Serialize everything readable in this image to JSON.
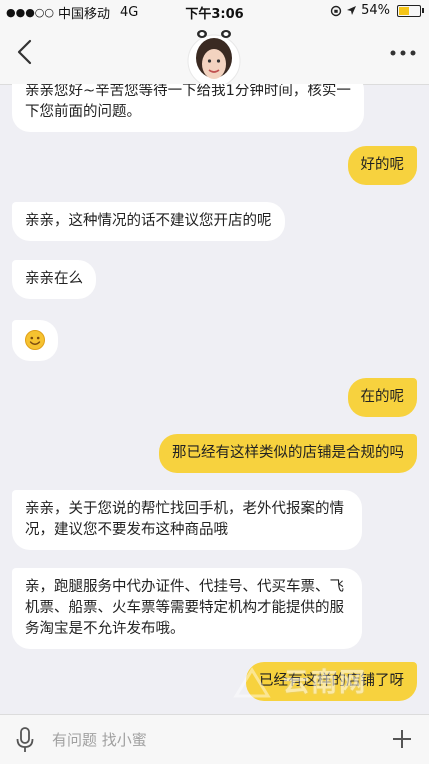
{
  "status_bar": {
    "signal": "●●●○○",
    "carrier": "中国移动",
    "network": "4G",
    "time": "下午3:06",
    "battery_percent": "54%",
    "battery_level": 0.54
  },
  "messages": [
    {
      "dir": "in",
      "text": "亲亲您好~辛苦您等待一下给我1分钟时间，核实一下您前面的问题。"
    },
    {
      "dir": "out",
      "text": "好的呢"
    },
    {
      "dir": "in",
      "text": "亲亲，这种情况的话不建议您开店的呢"
    },
    {
      "dir": "in",
      "text": "亲亲在么"
    },
    {
      "dir": "in",
      "text": "",
      "emoji": "smile-emoji"
    },
    {
      "dir": "out",
      "text": "在的呢"
    },
    {
      "dir": "out",
      "text": "那已经有这样类似的店铺是合规的吗"
    },
    {
      "dir": "in",
      "text": "亲亲，关于您说的帮忙找回手机，老外代报案的情况，建议您不要发布这种商品哦"
    },
    {
      "dir": "in",
      "text": "亲，跑腿服务中代办证件、代挂号、代买车票、飞机票、船票、火车票等需要特定机构才能提供的服务淘宝是不允许发布哦。"
    },
    {
      "dir": "out",
      "text": "已经有这样的店铺了呀"
    }
  ],
  "watermark": "云南网",
  "input": {
    "placeholder": "有问题 找小蜜"
  },
  "colors": {
    "outgoing_bubble": "#f7d23e",
    "incoming_bubble": "#ffffff",
    "background": "#efeff4"
  }
}
